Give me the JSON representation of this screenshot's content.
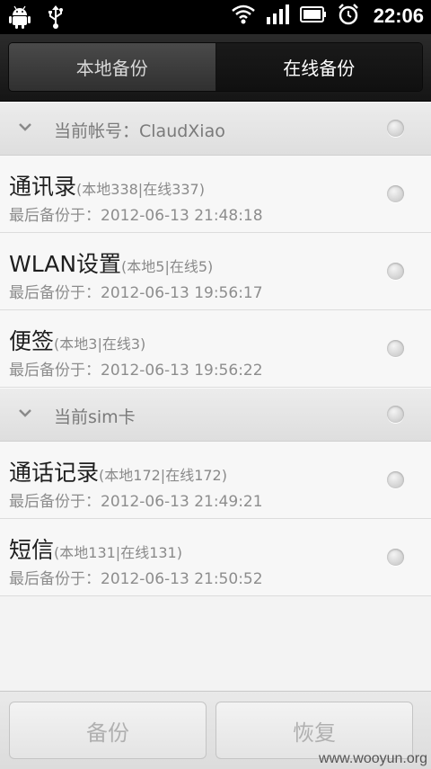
{
  "statusbar": {
    "time": "22:06"
  },
  "tabs": [
    {
      "label": "本地备份",
      "active": false
    },
    {
      "label": "在线备份",
      "active": true
    }
  ],
  "sections": [
    {
      "title": "当前帐号：ClaudXiao",
      "items": [
        {
          "name": "通讯录",
          "counts": "(本地338|在线337)",
          "date": "最后备份于：2012-06-13 21:48:18"
        },
        {
          "name": "WLAN设置",
          "counts": "(本地5|在线5)",
          "date": "最后备份于：2012-06-13 19:56:17"
        },
        {
          "name": "便签",
          "counts": "(本地3|在线3)",
          "date": "最后备份于：2012-06-13 19:56:22"
        }
      ]
    },
    {
      "title": "当前sim卡",
      "items": [
        {
          "name": "通话记录",
          "counts": "(本地172|在线172)",
          "date": "最后备份于：2012-06-13 21:49:21"
        },
        {
          "name": "短信",
          "counts": "(本地131|在线131)",
          "date": "最后备份于：2012-06-13 21:50:52"
        }
      ]
    }
  ],
  "buttons": {
    "backup": "备份",
    "restore": "恢复"
  },
  "watermark": "www.wooyun.org"
}
